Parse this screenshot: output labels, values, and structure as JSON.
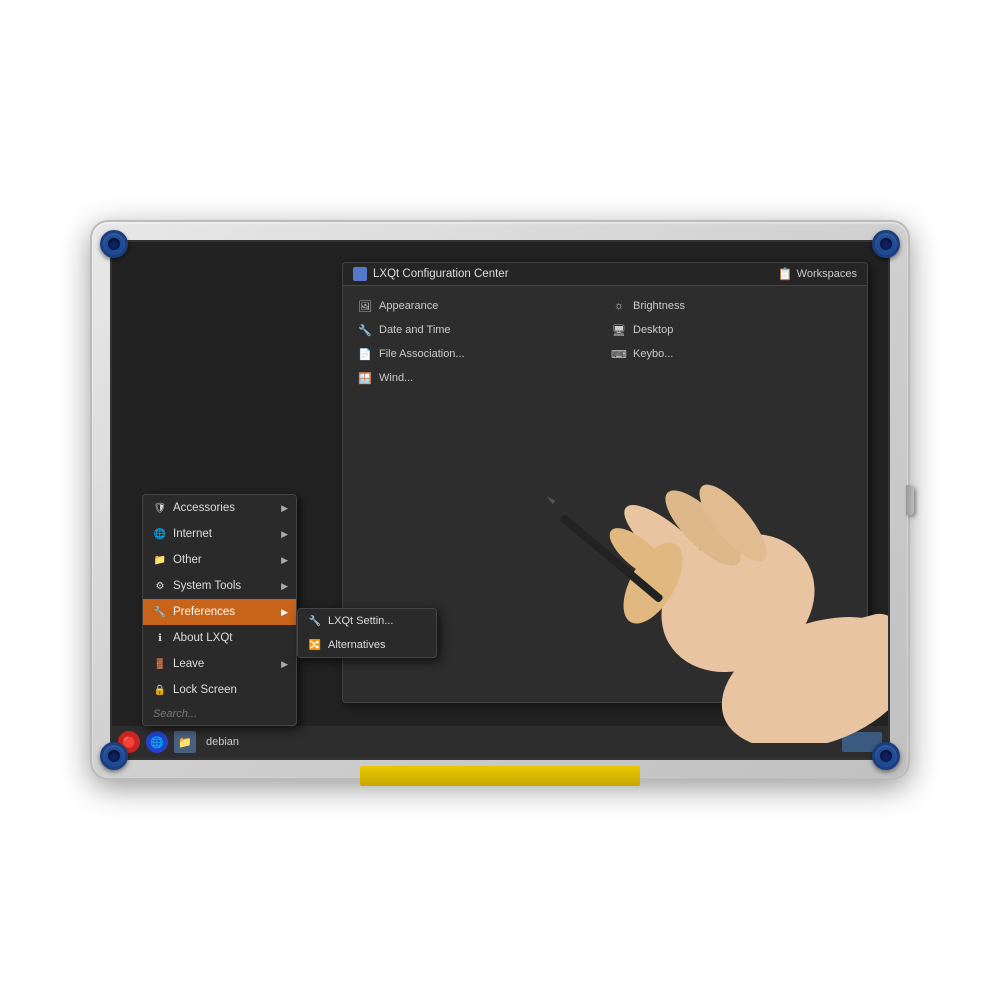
{
  "device": {
    "screen_bg": "#1a1a1a"
  },
  "menu": {
    "items": [
      {
        "id": "accessories",
        "label": "Accessories",
        "icon": "🛡",
        "hasArrow": true
      },
      {
        "id": "internet",
        "label": "Internet",
        "icon": "🌐",
        "hasArrow": true
      },
      {
        "id": "other",
        "label": "Other",
        "icon": "📁",
        "hasArrow": true
      },
      {
        "id": "system-tools",
        "label": "System Tools",
        "icon": "⚙",
        "hasArrow": true
      },
      {
        "id": "preferences",
        "label": "Preferences",
        "icon": "🔧",
        "hasArrow": true,
        "active": true
      },
      {
        "id": "about-lxqt",
        "label": "About LXQt",
        "icon": "ℹ",
        "hasArrow": false
      },
      {
        "id": "leave",
        "label": "Leave",
        "icon": "🚪",
        "hasArrow": true
      },
      {
        "id": "lock-screen",
        "label": "Lock Screen",
        "icon": "🔒",
        "hasArrow": false
      }
    ],
    "search_placeholder": "Search..."
  },
  "submenu": {
    "items": [
      {
        "id": "lxqt-settings",
        "label": "LXQt Settin...",
        "icon": "🔧"
      },
      {
        "id": "alternatives",
        "label": "Alternatives",
        "icon": "🔀"
      }
    ]
  },
  "config_panel": {
    "title": "LXQt Configuration Center",
    "workspaces_label": "Workspaces",
    "items": [
      {
        "id": "appearance",
        "label": "Appearance",
        "icon": "🖼"
      },
      {
        "id": "brightness",
        "label": "Brightness",
        "icon": "☀"
      },
      {
        "id": "date-time",
        "label": "Date and Time",
        "icon": "🔧"
      },
      {
        "id": "desktop",
        "label": "Desktop",
        "icon": "🖥"
      },
      {
        "id": "file-association",
        "label": "File Association...",
        "icon": "📄"
      },
      {
        "id": "keyboard",
        "label": "Keybo...",
        "icon": "⌨"
      },
      {
        "id": "window",
        "label": "Wind...",
        "icon": "🪟"
      }
    ]
  },
  "taskbar": {
    "app_icon1": "🔴",
    "app_icon2": "🔵",
    "app_icon3": "📁",
    "label": "debian"
  }
}
